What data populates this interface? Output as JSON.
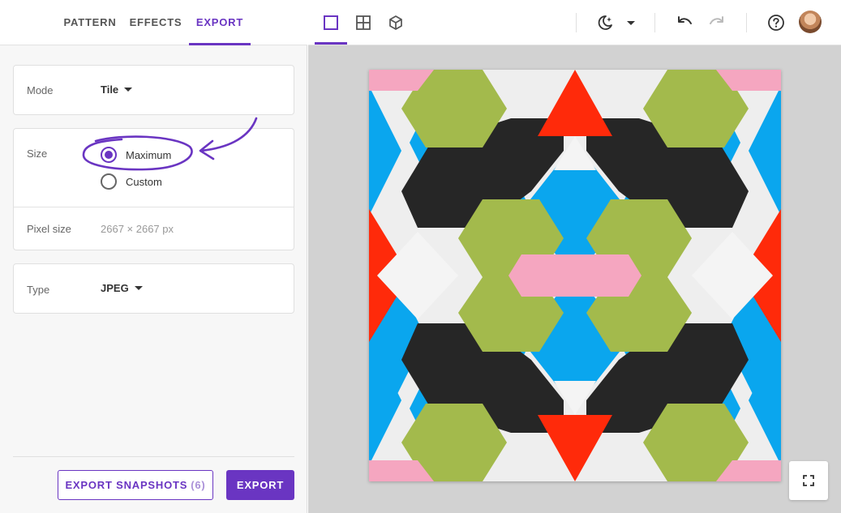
{
  "tabs": [
    {
      "label": "PATTERN",
      "active": false
    },
    {
      "label": "EFFECTS",
      "active": false
    },
    {
      "label": "EXPORT",
      "active": true
    }
  ],
  "mode": {
    "label": "Mode",
    "value": "Tile"
  },
  "size": {
    "label": "Size",
    "options": [
      {
        "label": "Maximum",
        "selected": true
      },
      {
        "label": "Custom",
        "selected": false
      }
    ],
    "pixel_size_label": "Pixel size",
    "pixel_size_value": "2667 × 2667 px"
  },
  "type": {
    "label": "Type",
    "value": "JPEG"
  },
  "buttons": {
    "export_snapshots_label": "EXPORT SNAPSHOTS",
    "export_snapshots_count": "(6)",
    "export_label": "EXPORT"
  },
  "toolbar": {
    "icons": [
      "single-view-icon",
      "grid-view-icon",
      "cube-view-icon",
      "theme-night-icon",
      "chevron-down-icon",
      "undo-icon",
      "redo-icon",
      "help-icon",
      "avatar"
    ]
  },
  "colors": {
    "accent": "#6a35c2",
    "blue": "#0aa6ee",
    "green": "#a3ba4c",
    "black": "#262626",
    "red": "#ff2a0a",
    "pink": "#f5a6c0",
    "white": "#eeeeee"
  }
}
